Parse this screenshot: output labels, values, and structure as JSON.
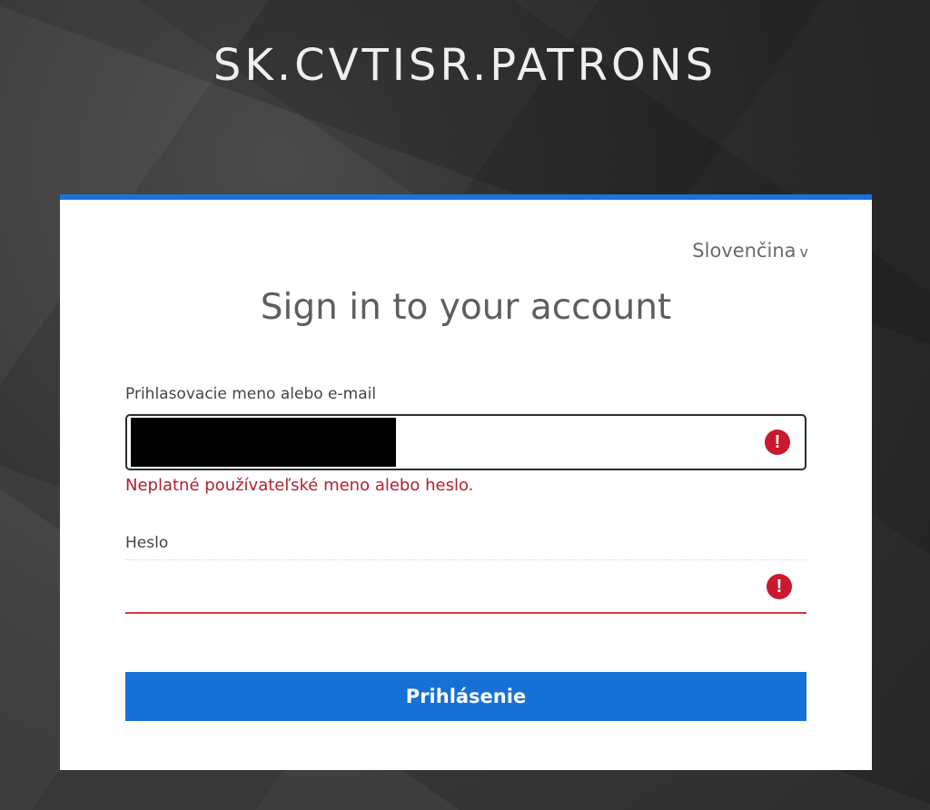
{
  "app_title": "SK.CVTISR.PATRONS",
  "colors": {
    "accent": "#1670d6",
    "top_border": "#1a73d9",
    "error": "#c9192e"
  },
  "language": {
    "selected": "Slovenčina",
    "chevron": "v"
  },
  "form": {
    "heading": "Sign in to your account",
    "username": {
      "label": "Prihlasovacie meno alebo e-mail",
      "value": "",
      "error_icon": "exclamation-circle-icon",
      "error_message": "Neplatné používateľské meno alebo heslo."
    },
    "password": {
      "label": "Heslo",
      "value": "",
      "error_icon": "exclamation-circle-icon"
    },
    "submit_label": "Prihlásenie"
  }
}
